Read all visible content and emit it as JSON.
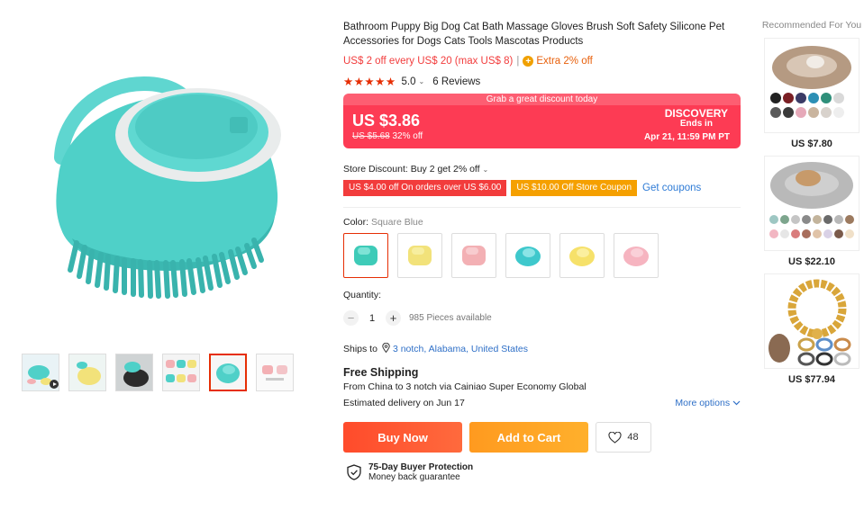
{
  "product": {
    "title": "Bathroom Puppy Big Dog Cat Bath Massage Gloves Brush Soft Safety Silicone Pet Accessories for Dogs Cats Tools Mascotas Products",
    "promo_text": "US$ 2 off every US$ 20 (max US$ 8)",
    "promo_separator": "|",
    "extra_text": "Extra 2% off",
    "stars": "★★★★★",
    "rating": "5.0",
    "reviews": "6 Reviews"
  },
  "deal": {
    "banner": "Grab a great discount today",
    "price": "US $3.86",
    "old_price": "US $5.68",
    "discount": "32% off",
    "event": "DISCOVERY",
    "ends": "Ends in",
    "end_date": "Apr 21, 11:59 PM PT",
    "colors": {
      "background": "#fd3b54"
    }
  },
  "store": {
    "discount_text": "Store Discount: Buy 2 get 2% off",
    "coupons": [
      "US $4.00 off On orders over US $6.00",
      "US $10.00 Off Store Coupon"
    ],
    "get_coupons": "Get coupons"
  },
  "color": {
    "label": "Color:",
    "value": "Square Blue",
    "swatches": [
      {
        "color": "#3ecbb8",
        "shape": "square"
      },
      {
        "color": "#f2e27a",
        "shape": "square"
      },
      {
        "color": "#f3b0b4",
        "shape": "square"
      },
      {
        "color": "#3ec8cc",
        "shape": "round"
      },
      {
        "color": "#f6e16a",
        "shape": "round"
      },
      {
        "color": "#f6b4c0",
        "shape": "round"
      }
    ]
  },
  "quantity": {
    "label": "Quantity:",
    "minus": "−",
    "value": "1",
    "plus": "+",
    "available": "985 Pieces available"
  },
  "shipping": {
    "ships_to_label": "Ships to",
    "location": "3 notch, Alabama, United States",
    "free": "Free Shipping",
    "from": "From China to 3 notch via Cainiao Super Economy Global",
    "estimate": "Estimated delivery on Jun 17",
    "more_options": "More options"
  },
  "actions": {
    "buy_now": "Buy Now",
    "add_to_cart": "Add to Cart",
    "wishlist_count": "48"
  },
  "protection": {
    "title": "75-Day Buyer Protection",
    "subtitle": "Money back guarantee"
  },
  "recommended": {
    "title": "Recommended For You",
    "items": [
      {
        "price": "US $7.80"
      },
      {
        "price": "US $22.10"
      },
      {
        "price": "US $77.94"
      }
    ]
  },
  "gallery": {
    "thumbs": [
      "video-thumb",
      "yellow-brush-thumb",
      "dog-bath-thumb",
      "color-grid-thumb",
      "blue-brush-thumb",
      "white-thumb"
    ],
    "active_index": 4
  }
}
